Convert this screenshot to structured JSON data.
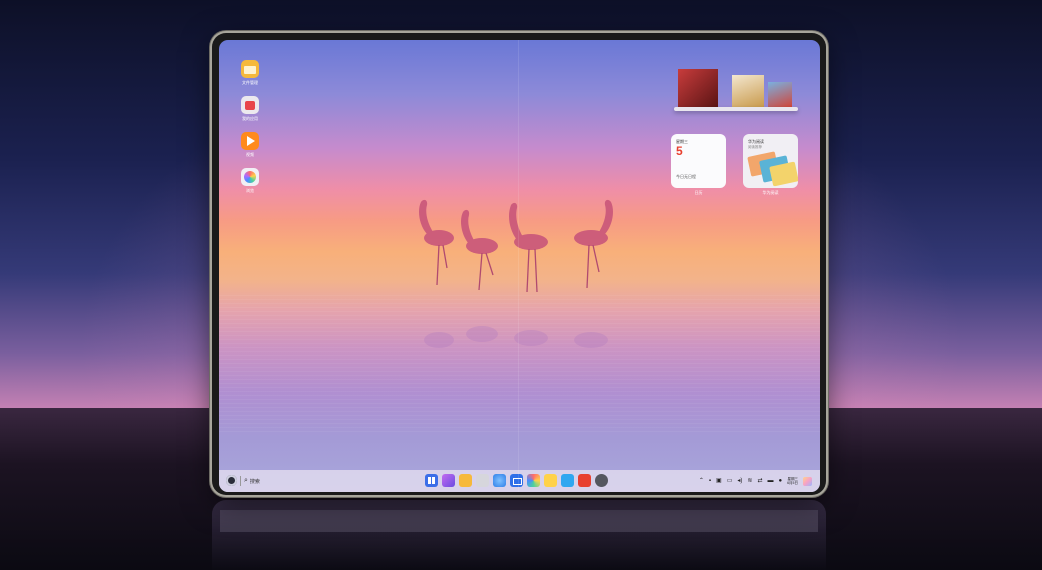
{
  "desktop": {
    "icons": [
      {
        "name": "file-manager-app",
        "label": "文件管理",
        "icon": "folder-icon",
        "color": "#f6b93b"
      },
      {
        "name": "my-apps-app",
        "label": "我的应用",
        "icon": "bag-icon",
        "color": "#e8e6ea"
      },
      {
        "name": "video-app",
        "label": "视频",
        "icon": "play-icon",
        "color": "#ff8a1c"
      },
      {
        "name": "browser-app",
        "label": "浏览",
        "icon": "compass-icon",
        "color": "#f1eff5"
      }
    ]
  },
  "widgets": {
    "calendar": {
      "weekday": "星期三",
      "day": "5",
      "note": "今日无日程",
      "caption": "日历"
    },
    "reader": {
      "title": "华为阅读",
      "subtitle": "阅读推荐",
      "caption": "华为阅读"
    },
    "music": {
      "albums": [
        "album-1",
        "album-2",
        "album-3"
      ]
    }
  },
  "taskbar": {
    "search_label": "搜索",
    "dock_apps": [
      {
        "name": "dock-app-grid",
        "color": "#3b6ee8"
      },
      {
        "name": "dock-app-gallery",
        "color": "#9b59e0"
      },
      {
        "name": "dock-app-files",
        "color": "#f6b93b"
      },
      {
        "name": "dock-app-trash",
        "color": "#b8b8c0"
      },
      {
        "name": "dock-app-browser",
        "color": "#2f8cff"
      },
      {
        "name": "dock-app-mail",
        "color": "#2f6fe8"
      },
      {
        "name": "dock-app-photos",
        "color": "#ff7a6b"
      },
      {
        "name": "dock-app-notes",
        "color": "#ffd24a"
      },
      {
        "name": "dock-app-docs",
        "color": "#2fa7f0"
      },
      {
        "name": "dock-app-calendar",
        "color": "#e8402f"
      },
      {
        "name": "dock-app-settings",
        "color": "#55575f"
      }
    ],
    "tray": {
      "clock_time": "星期三",
      "clock_date": "6月5日"
    }
  }
}
